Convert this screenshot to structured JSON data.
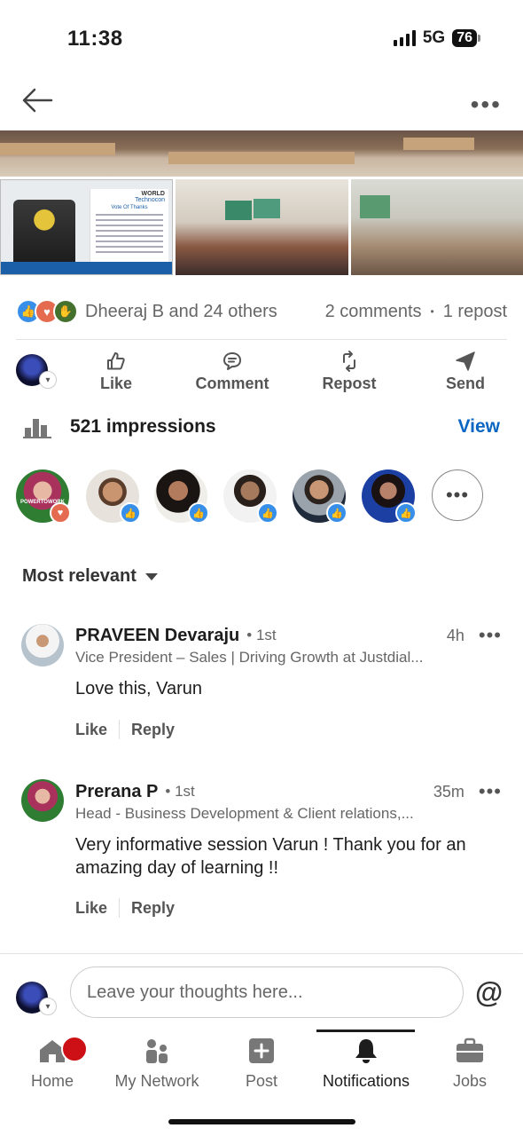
{
  "status_bar": {
    "time": "11:38",
    "network": "5G",
    "battery": "76"
  },
  "post": {
    "reactions": {
      "summary": "Dheeraj B and 24 others",
      "comments": "2 comments",
      "reposts": "1 repost"
    },
    "actions": {
      "like": "Like",
      "comment": "Comment",
      "repost": "Repost",
      "send": "Send"
    },
    "impressions": {
      "label": "521 impressions",
      "view": "View"
    },
    "photo_texts": {
      "world": "WORLD",
      "techno": "Technocon",
      "thanks": "Vote Of Thanks"
    },
    "reactor_badge_label": "POWERTOWORK"
  },
  "comments": {
    "sort_label": "Most relevant",
    "items": [
      {
        "name": "PRAVEEN Devaraju",
        "degree": "• 1st",
        "time": "4h",
        "headline": "Vice President – Sales | Driving Growth at Justdial...",
        "text": "Love this, Varun",
        "like": "Like",
        "reply": "Reply"
      },
      {
        "name": "Prerana P",
        "degree": "• 1st",
        "time": "35m",
        "headline": "Head - Business Development & Client relations,...",
        "text": "Very informative session Varun ! Thank you for an amazing day of learning !!",
        "like": "Like",
        "reply": "Reply"
      }
    ]
  },
  "composer": {
    "placeholder": "Leave your thoughts here...",
    "mention": "@"
  },
  "nav": {
    "items": [
      {
        "label": "Home",
        "icon": "home-icon"
      },
      {
        "label": "My Network",
        "icon": "network-icon"
      },
      {
        "label": "Post",
        "icon": "post-icon"
      },
      {
        "label": "Notifications",
        "icon": "bell-icon"
      },
      {
        "label": "Jobs",
        "icon": "briefcase-icon"
      }
    ],
    "active": "Notifications"
  },
  "colors": {
    "accent": "#0a66c2",
    "notification_dot": "#cc1016",
    "text": "#1d1d1d",
    "muted": "#666666"
  }
}
